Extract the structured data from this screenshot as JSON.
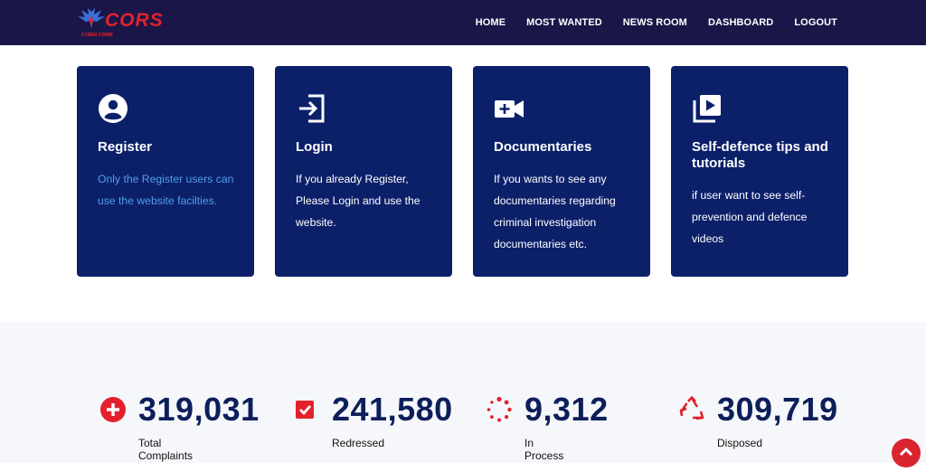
{
  "brand": {
    "name": "CORS",
    "tagline": "CYBER CRIME"
  },
  "nav": [
    {
      "label": "HOME"
    },
    {
      "label": "MOST WANTED"
    },
    {
      "label": "NEWS ROOM"
    },
    {
      "label": "DASHBOARD"
    },
    {
      "label": "LOGOUT"
    }
  ],
  "cards": [
    {
      "icon": "user-circle-icon",
      "title": "Register",
      "lines": [
        "Only the Register users can",
        "use the website facilties."
      ]
    },
    {
      "icon": "login-icon",
      "title": "Login",
      "lines": [
        "If you already Register,",
        "Please Login and use the",
        "website."
      ]
    },
    {
      "icon": "video-camera-icon",
      "title": "Documentaries",
      "lines": [
        "If you wants to see any",
        "documentaries regarding",
        "criminal investigation",
        "documentaries etc."
      ]
    },
    {
      "icon": "play-library-icon",
      "title_lines": [
        "Self-defence tips and",
        "tutorials"
      ],
      "lines": [
        "if user want to see self-",
        "prevention and defence",
        "videos"
      ]
    }
  ],
  "stats": [
    {
      "icon": "plus-circle-icon",
      "value": "319,031",
      "label": "Total Complaints"
    },
    {
      "icon": "check-square-icon",
      "value": "241,580",
      "label": "Redressed"
    },
    {
      "icon": "spinner-icon",
      "value": "9,312",
      "label": "In Process"
    },
    {
      "icon": "recycle-icon",
      "value": "309,719",
      "label": "Disposed"
    }
  ],
  "colors": {
    "nav_bg": "#1a1648",
    "card_bg": "#0c206a",
    "accent_red": "#e3212d",
    "stat_number": "#0d1e5b",
    "link_blue": "#4f9fe6"
  }
}
